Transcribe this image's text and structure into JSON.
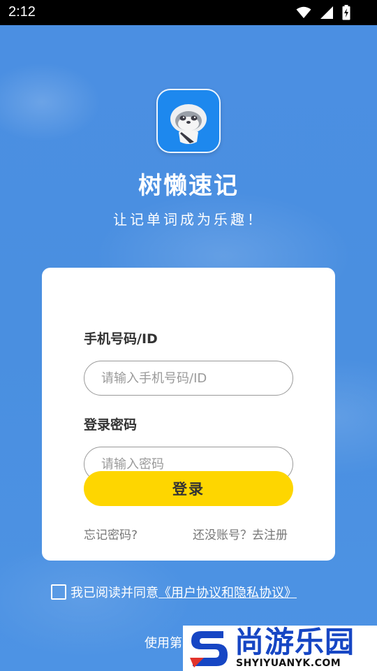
{
  "status_bar": {
    "time": "2:12",
    "icons": [
      "wifi-icon",
      "signal-icon",
      "battery-icon"
    ]
  },
  "app": {
    "name": "树懒速记",
    "slogan": "让记单词成为乐趣！",
    "logo_icon": "sloth-logo-icon"
  },
  "login_form": {
    "phone_label": "手机号码/ID",
    "phone_placeholder": "请输入手机号码/ID",
    "phone_value": "",
    "password_label": "登录密码",
    "password_placeholder": "请输入密码",
    "password_value": "",
    "login_button": "登录",
    "forgot_link": "忘记密码?",
    "register_link": "还没账号？去注册"
  },
  "agreement": {
    "checked": false,
    "prefix": "我已阅读并同意",
    "link_text": "《用户协议和隐私协议》"
  },
  "footer": {
    "partial_text": "使用第"
  },
  "watermark": {
    "title": "尚游乐园",
    "url": "SHYIYUANYK.COM"
  },
  "colors": {
    "background": "#4a8fe0",
    "button": "#fed600",
    "card": "#ffffff",
    "watermark_blue": "#1646c4",
    "watermark_red": "#e2332b"
  }
}
